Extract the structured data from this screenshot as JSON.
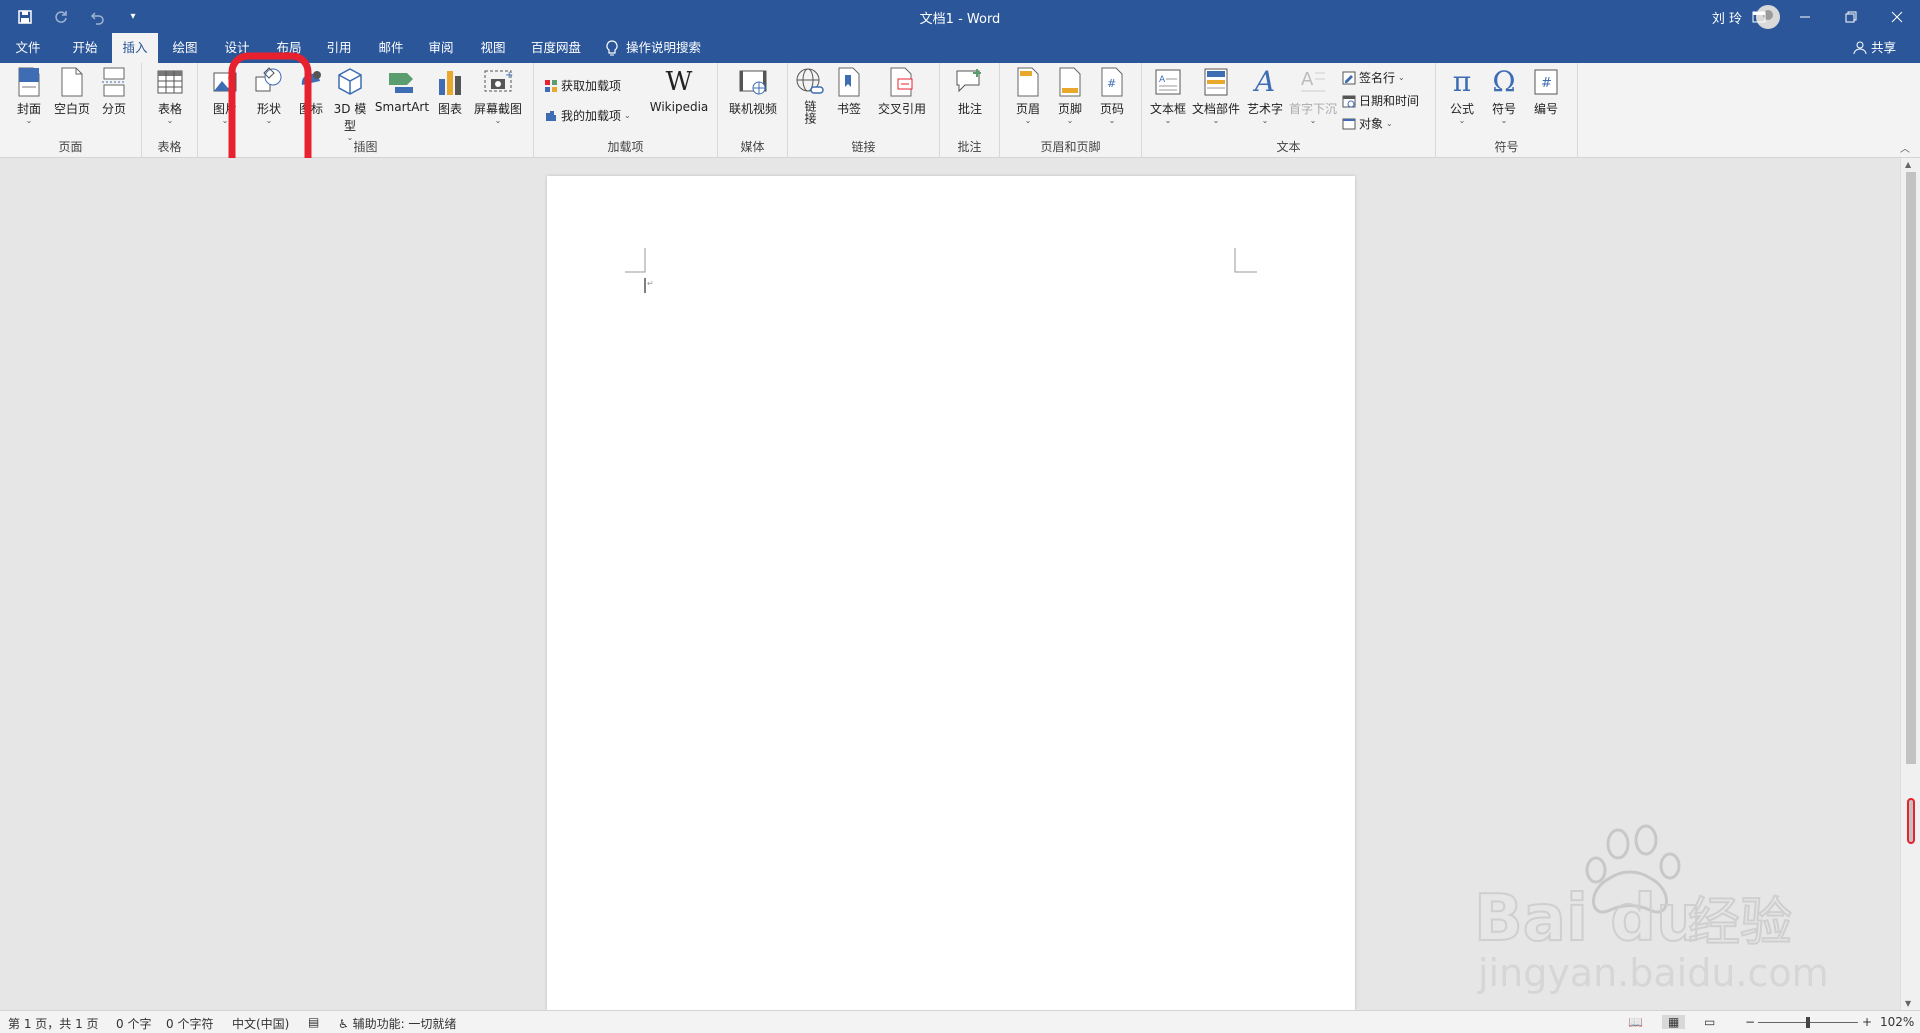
{
  "window": {
    "title": "文档1  -  Word",
    "user": "刘 玲"
  },
  "tabs": [
    "文件",
    "开始",
    "插入",
    "绘图",
    "设计",
    "布局",
    "引用",
    "邮件",
    "审阅",
    "视图",
    "百度网盘"
  ],
  "active_tab": "插入",
  "tell_me": "操作说明搜索",
  "share": "共享",
  "ribbon": {
    "page": {
      "label": "页面",
      "cover": "封面",
      "blank": "空白页",
      "break": "分页"
    },
    "table": {
      "label": "表格",
      "table": "表格"
    },
    "illus": {
      "label": "插图",
      "picture": "图片",
      "shapes": "形状",
      "icons": "图标",
      "model": "3D 模型",
      "smartart": "SmartArt",
      "chart": "图表",
      "screenshot": "屏幕截图"
    },
    "addins": {
      "label": "加载项",
      "get": "获取加载项",
      "mine": "我的加载项",
      "wiki": "Wikipedia"
    },
    "media": {
      "label": "媒体",
      "video": "联机视频"
    },
    "links": {
      "label": "链接",
      "link": "链接",
      "bookmark": "书签",
      "xref": "交叉引用"
    },
    "comments": {
      "label": "批注",
      "comment": "批注"
    },
    "hf": {
      "label": "页眉和页脚",
      "header": "页眉",
      "footer": "页脚",
      "pagenum": "页码"
    },
    "text": {
      "label": "文本",
      "textbox": "文本框",
      "parts": "文档部件",
      "wordart": "艺术字",
      "dropcap": "首字下沉",
      "sig": "签名行",
      "datetime": "日期和时间",
      "object": "对象"
    },
    "symbols": {
      "label": "符号",
      "equation": "公式",
      "symbol": "符号",
      "number": "编号"
    }
  },
  "status": {
    "page": "第 1 页，共 1 页",
    "words": "0 个字",
    "chars": "0 个字符",
    "lang": "中文(中国)",
    "access": "辅助功能: 一切就绪",
    "zoom": "102%"
  },
  "watermark": {
    "brand": "Bai  du",
    "cn": "经验",
    "url": "jingyan.baidu.com"
  },
  "colors": {
    "brand": "#2b579a",
    "highlight": "#e8212e"
  }
}
